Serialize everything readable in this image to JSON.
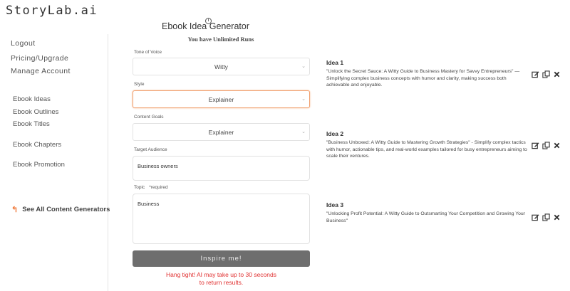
{
  "app": {
    "logo": "StoryLab.ai"
  },
  "sidebar": {
    "logout": "Logout",
    "pricing": "Pricing/Upgrade",
    "manage": "Manage Account",
    "items": [
      "Ebook Ideas",
      "Ebook Outlines",
      "Ebook Titles",
      "Ebook Chapters",
      "Ebook Promotion"
    ],
    "see_all": "See All Content Generators"
  },
  "form": {
    "title": "Ebook Idea Generator",
    "runs": "You have Unlimited Runs",
    "tone_label": "Tone of Voice",
    "tone_value": "Witty",
    "style_label": "Style",
    "style_value": "Explainer",
    "goals_label": "Content Goals",
    "goals_value": "Explainer",
    "audience_label": "Target Audience",
    "audience_value": "Business owners",
    "topic_label": "Topic",
    "topic_required": "*required",
    "topic_value": "Business",
    "button": "Inspire me!",
    "wait_line1": "Hang tight! AI may take up to 30 seconds",
    "wait_line2": "to return results."
  },
  "ideas": [
    {
      "title": "Idea 1",
      "text": "\"Unlock the Secret Sauce: A Witty Guide to Business Mastery for Savvy Entrepreneurs\" — Simplifying complex business concepts with humor and clarity, making success both achievable and enjoyable."
    },
    {
      "title": "Idea 2",
      "text": "\"Business Unboxed: A Witty Guide to Mastering Growth Strategies\" - Simplify complex tactics with humor, actionable tips, and real-world examples tailored for busy entrepreneurs aiming to scale their ventures."
    },
    {
      "title": "Idea 3",
      "text": "\"Unlocking Profit Potential: A Witty Guide to Outsmarting Your Competition and Growing Your Business\""
    }
  ],
  "icons": {
    "info": "info-icon",
    "edit": "edit-icon",
    "copy": "copy-icon",
    "delete": "close-icon",
    "back": "back-arrow-icon",
    "caret": "chevron-down-icon"
  },
  "colors": {
    "accent": "#f0793a",
    "button": "#6e6e6e",
    "warning": "#e02f2f"
  }
}
